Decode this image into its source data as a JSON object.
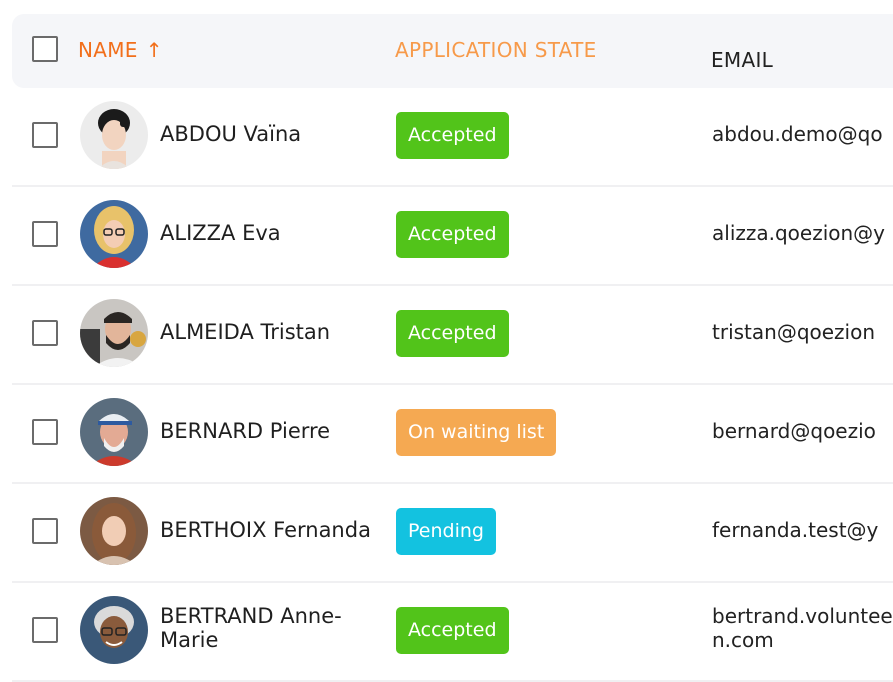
{
  "header": {
    "name_label": "NAME",
    "sort_glyph": "↑",
    "state_label": "APPLICATION STATE",
    "email_label": "EMAIL"
  },
  "colors": {
    "accepted": "#52c41a",
    "waiting": "#f5a952",
    "pending": "#13c2e0",
    "header_active": "#f26f1b",
    "header_inactive": "#f79a4a"
  },
  "rows": [
    {
      "name": "ABDOU Vaïna",
      "status": "Accepted",
      "status_kind": "accepted",
      "email": "abdou.demo@qo",
      "avatar": "woman-dark-hair-avatar"
    },
    {
      "name": "ALIZZA Eva",
      "status": "Accepted",
      "status_kind": "accepted",
      "email": "alizza.qoezion@y",
      "avatar": "woman-glasses-avatar"
    },
    {
      "name": "ALMEIDA Tristan",
      "status": "Accepted",
      "status_kind": "accepted",
      "email": "tristan@qoezion",
      "avatar": "man-beard-avatar"
    },
    {
      "name": "BERNARD Pierre",
      "status": "On waiting list",
      "status_kind": "waiting",
      "email": "bernard@qoezio",
      "avatar": "old-man-cap-avatar"
    },
    {
      "name": "BERTHOIX Fernanda",
      "status": "Pending",
      "status_kind": "pending",
      "email": "fernanda.test@y",
      "avatar": "woman-long-hair-avatar"
    },
    {
      "name": "BERTRAND Anne-Marie",
      "status": "Accepted",
      "status_kind": "accepted",
      "email": "bertrand.volunteen.com",
      "avatar": "woman-smiling-avatar"
    }
  ]
}
